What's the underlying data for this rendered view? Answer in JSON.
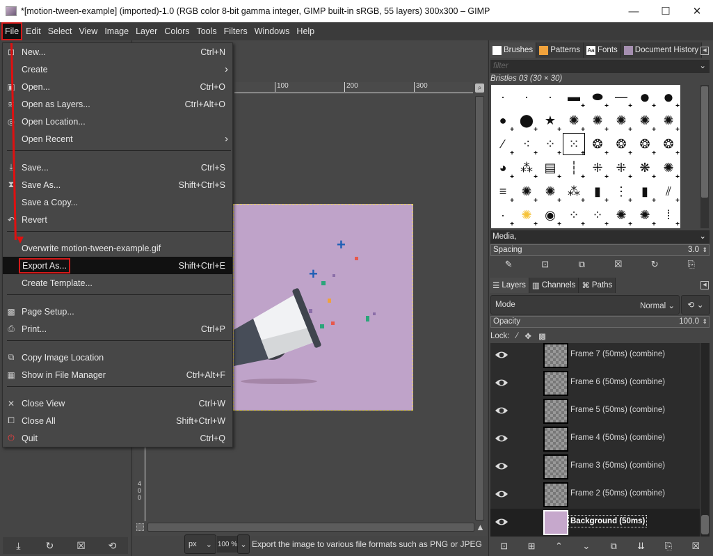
{
  "window": {
    "title": "*[motion-tween-example] (imported)-1.0 (RGB color 8-bit gamma integer, GIMP built-in sRGB, 55 layers) 300x300 – GIMP",
    "minimize_glyph": "—",
    "maximize_glyph": "☐",
    "close_glyph": "✕"
  },
  "menubar": [
    "File",
    "Edit",
    "Select",
    "View",
    "Image",
    "Layer",
    "Colors",
    "Tools",
    "Filters",
    "Windows",
    "Help"
  ],
  "file_menu": {
    "items": [
      {
        "label": "New...",
        "shortcut": "Ctrl+N",
        "icon": "new-image-icon"
      },
      {
        "label": "Create",
        "shortcut": "",
        "submenu": true
      },
      {
        "label": "Open...",
        "shortcut": "Ctrl+O",
        "icon": "open-icon"
      },
      {
        "label": "Open as Layers...",
        "shortcut": "Ctrl+Alt+O",
        "icon": "open-layers-icon"
      },
      {
        "label": "Open Location...",
        "shortcut": "",
        "icon": "open-location-icon"
      },
      {
        "label": "Open Recent",
        "shortcut": "",
        "submenu": true
      },
      {
        "label": "Save...",
        "shortcut": "Ctrl+S",
        "icon": "save-icon"
      },
      {
        "label": "Save As...",
        "shortcut": "Shift+Ctrl+S",
        "icon": "save-as-icon"
      },
      {
        "label": "Save a Copy...",
        "shortcut": ""
      },
      {
        "label": "Revert",
        "shortcut": "",
        "icon": "revert-icon"
      },
      {
        "label": "Overwrite motion-tween-example.gif",
        "shortcut": ""
      },
      {
        "label": "Export As...",
        "shortcut": "Shift+Ctrl+E",
        "highlighted": true
      },
      {
        "label": "Create Template...",
        "shortcut": ""
      },
      {
        "label": "Page Setup...",
        "shortcut": "",
        "icon": "page-setup-icon"
      },
      {
        "label": "Print...",
        "shortcut": "Ctrl+P",
        "icon": "print-icon"
      },
      {
        "label": "Copy Image Location",
        "shortcut": "",
        "icon": "copy-location-icon"
      },
      {
        "label": "Show in File Manager",
        "shortcut": "Ctrl+Alt+F",
        "icon": "file-manager-icon"
      },
      {
        "label": "Close View",
        "shortcut": "Ctrl+W",
        "icon": "close-view-icon"
      },
      {
        "label": "Close All",
        "shortcut": "Shift+Ctrl+W",
        "icon": "close-all-icon"
      },
      {
        "label": "Quit",
        "shortcut": "Ctrl+Q",
        "icon": "quit-icon"
      }
    ],
    "submenu_glyph": "›"
  },
  "canvas": {
    "ruler_h_labels": [
      "100",
      "200",
      "300"
    ],
    "ruler_v_label": "400",
    "image_background": "#bfa3c9"
  },
  "statusbar": {
    "unit": "px",
    "zoom": "100 %",
    "message": "Export the image to various file formats such as PNG or JPEG"
  },
  "brushes_dock": {
    "tabs": [
      "Brushes",
      "Patterns",
      "Fonts",
      "Document History"
    ],
    "filter_placeholder": "filter",
    "selected_brush": "Bristles 03 (30 × 30)",
    "tag": "Media,",
    "spacing_label": "Spacing",
    "spacing_value": "3.0"
  },
  "layers_dock": {
    "tabs": [
      "Layers",
      "Channels",
      "Paths"
    ],
    "mode_label": "Mode",
    "mode_value": "Normal",
    "opacity_label": "Opacity",
    "opacity_value": "100.0",
    "lock_label": "Lock:",
    "layers": [
      {
        "name": "Frame 7 (50ms) (combine)",
        "visible": true
      },
      {
        "name": "Frame 6 (50ms) (combine)",
        "visible": true
      },
      {
        "name": "Frame 5 (50ms) (combine)",
        "visible": true
      },
      {
        "name": "Frame 4 (50ms) (combine)",
        "visible": true
      },
      {
        "name": "Frame 3 (50ms) (combine)",
        "visible": true
      },
      {
        "name": "Frame 2 (50ms) (combine)",
        "visible": true
      },
      {
        "name": "Background (50ms)",
        "visible": true,
        "selected": true
      }
    ]
  },
  "colors": {
    "highlight_outline": "#d51a1a",
    "annotation_arrow": "#e01010"
  }
}
